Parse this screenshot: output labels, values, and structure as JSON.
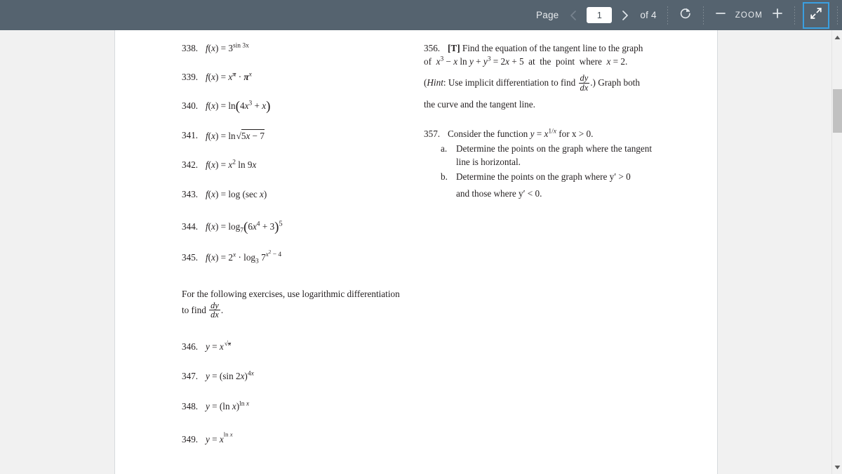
{
  "toolbar": {
    "page_label": "Page",
    "page_value": "1",
    "page_total": "of 4",
    "zoom_label": "ZOOM",
    "prev_icon": "chevron-left-icon",
    "next_icon": "chevron-right-icon",
    "refresh_icon": "rotate-refresh-icon",
    "zoom_out_icon": "minus-icon",
    "zoom_in_icon": "plus-icon",
    "fullscreen_icon": "exit-fullscreen-icon",
    "accent_color": "#3a9fe0",
    "background_color": "#55636f"
  },
  "document": {
    "left_column": {
      "exercises": [
        {
          "num": "338.",
          "kind": "f3sin"
        },
        {
          "num": "339.",
          "kind": "fxpi"
        },
        {
          "num": "340.",
          "kind": "fln4x3"
        },
        {
          "num": "341.",
          "kind": "flnrad"
        },
        {
          "num": "342.",
          "kind": "fx2ln9x"
        },
        {
          "num": "343.",
          "kind": "flogsec"
        },
        {
          "num": "344.",
          "kind": "flog7"
        },
        {
          "num": "345.",
          "kind": "f2xlog3"
        }
      ],
      "instruction": "For the following exercises, use logarithmic differentiation to find",
      "instruction_math": "dy/dx",
      "instruction_prefix": "For the following exercises, use logarithmic differentiation",
      "instruction_suffix": "to find",
      "exercises2": [
        {
          "num": "346.",
          "kind": "yxsqrtx"
        },
        {
          "num": "347.",
          "kind": "ysin2x"
        },
        {
          "num": "348.",
          "kind": "ylnxlnx"
        },
        {
          "num": "349.",
          "kind": "yxlnx"
        }
      ]
    },
    "right_column": {
      "ex356": {
        "num": "356.",
        "tag": "[T]",
        "line1": "Find the equation of the tangent line to the graph",
        "line2_pre": "of",
        "line2_math": "x³ − x ln y + y³ = 2x + 5",
        "line2_mid": "at the point where",
        "line2_end": "x = 2.",
        "hint_label": "Hint",
        "hint_text": ": Use implicit differentiation to find",
        "hint_frac_n": "dy",
        "hint_frac_d": "dx",
        "hint_after": ".) Graph both",
        "line4": "the curve and the tangent line."
      },
      "ex357": {
        "num": "357.",
        "stem_pre": "Consider the function",
        "stem_math": "y = x^(1/x)",
        "stem_post": "for  x > 0.",
        "parts": [
          {
            "label": "a.",
            "text": "Determine the points on the graph where the tangent line is horizontal."
          },
          {
            "label": "b.",
            "text_line1": "Determine the points on the graph where  y′ > 0",
            "text_line2": "and those where  y′ < 0."
          }
        ]
      }
    }
  },
  "scrollbar": {
    "up_icon": "scroll-up-arrow-icon",
    "down_icon": "scroll-down-arrow-icon"
  }
}
